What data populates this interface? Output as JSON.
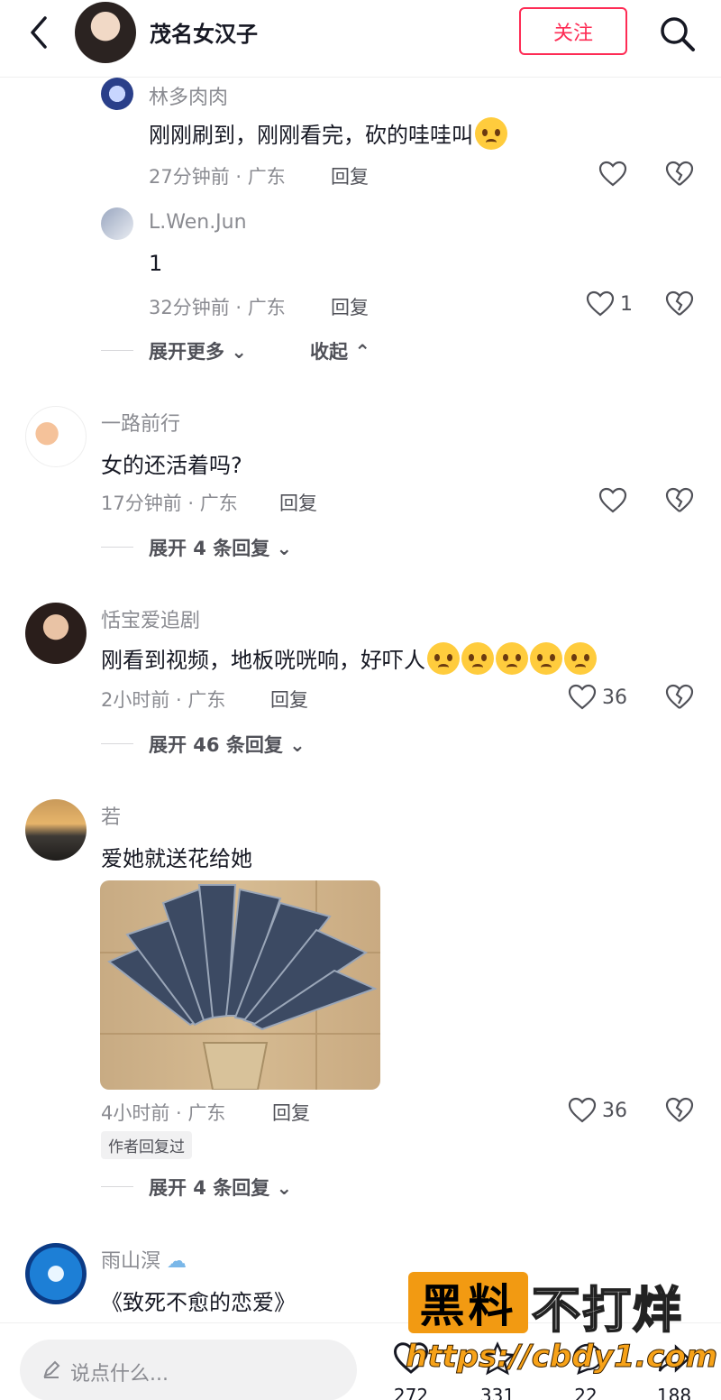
{
  "header": {
    "username": "茂名女汉子",
    "follow_label": "关注"
  },
  "comments": [
    {
      "name": "林多肉肉",
      "text": "刚刚刷到，刚刚看完，砍的哇哇叫",
      "time": "27分钟前 · 广东",
      "reply_label": "回复",
      "likes": ""
    },
    {
      "name": "L.Wen.Jun",
      "text": "1",
      "time": "32分钟前 · 广东",
      "reply_label": "回复",
      "likes": "1"
    },
    {
      "name": "一路前行",
      "text": "女的还活着吗?",
      "time": "17分钟前 · 广东",
      "reply_label": "回复",
      "likes": "",
      "expand": "展开 4 条回复"
    },
    {
      "name": "恬宝爱追剧",
      "text": "刚看到视频，地板咣咣响，好吓人",
      "time": "2小时前 · 广东",
      "reply_label": "回复",
      "likes": "36",
      "expand": "展开 46 条回复"
    },
    {
      "name": "若",
      "text": "爱她就送花给她",
      "time": "4小时前 · 广东",
      "reply_label": "回复",
      "likes": "36",
      "badge": "作者回复过",
      "expand": "展开 4 条回复"
    },
    {
      "name": "雨山溟",
      "text": "《致死不愈的恋爱》"
    }
  ],
  "thread_controls": {
    "expand_more": "展开更多",
    "collapse": "收起"
  },
  "bottom_bar": {
    "input_placeholder": "说点什么...",
    "stats": [
      "272",
      "331",
      "22",
      "188"
    ]
  },
  "watermark": {
    "box_text": "黑料",
    "text": "不打烊",
    "url": "https://cbdy1.com"
  },
  "colors": {
    "accent": "#fe2c55",
    "muted": "#8a8b91",
    "watermark_orange": "#f29a12"
  }
}
